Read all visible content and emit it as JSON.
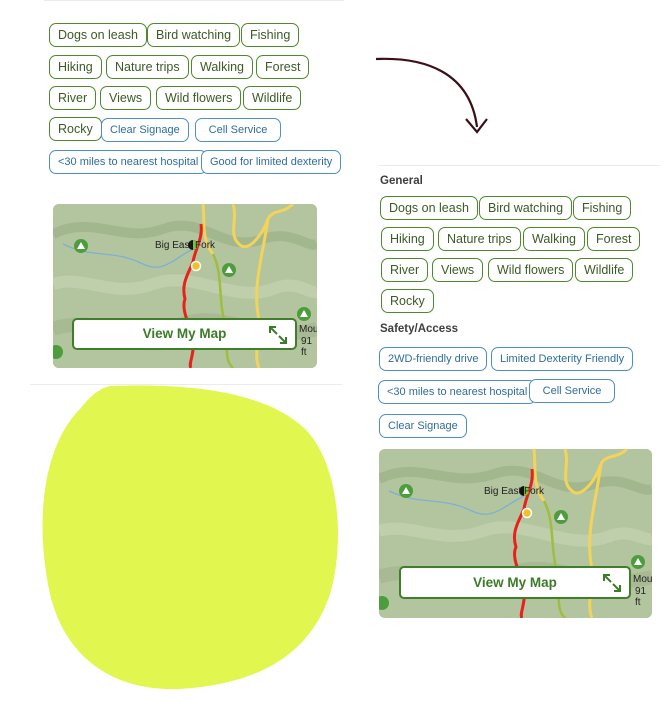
{
  "left_panel": {
    "tags_green": [
      "Dogs on leash",
      "Bird watching",
      "Fishing",
      "Hiking",
      "Nature trips",
      "Walking",
      "Forest",
      "River",
      "Views",
      "Wild flowers",
      "Wildlife",
      "Rocky"
    ],
    "tags_blue": [
      "Clear Signage",
      "Cell Service",
      "<30 miles to nearest hospital",
      "Good for limited dexterity"
    ],
    "map": {
      "button_label": "View My Map",
      "place_label": "Big East Fork",
      "peak_label": "Moun",
      "elev_label": "91 ft"
    }
  },
  "right_panel": {
    "general_heading": "General",
    "tags_green": [
      "Dogs on leash",
      "Bird watching",
      "Fishing",
      "Hiking",
      "Nature trips",
      "Walking",
      "Forest",
      "River",
      "Views",
      "Wild flowers",
      "Wildlife",
      "Rocky"
    ],
    "safety_heading": "Safety/Access",
    "tags_blue": [
      "2WD-friendly drive",
      "Limited Dexterity Friendly",
      "<30 miles to nearest hospital",
      "Cell Service",
      "Clear Signage"
    ],
    "map": {
      "button_label": "View My Map",
      "place_label": "Big East Fork",
      "peak_label": "Moun",
      "elev_label": "91 ft"
    }
  },
  "colors": {
    "tag_green": "#4d8a2b",
    "tag_blue": "#4e8fc4",
    "blob": "#e1f64e",
    "arrow": "#3b0f17",
    "trail_red": "#e8211d",
    "trail_yellow": "#f3d35a"
  }
}
